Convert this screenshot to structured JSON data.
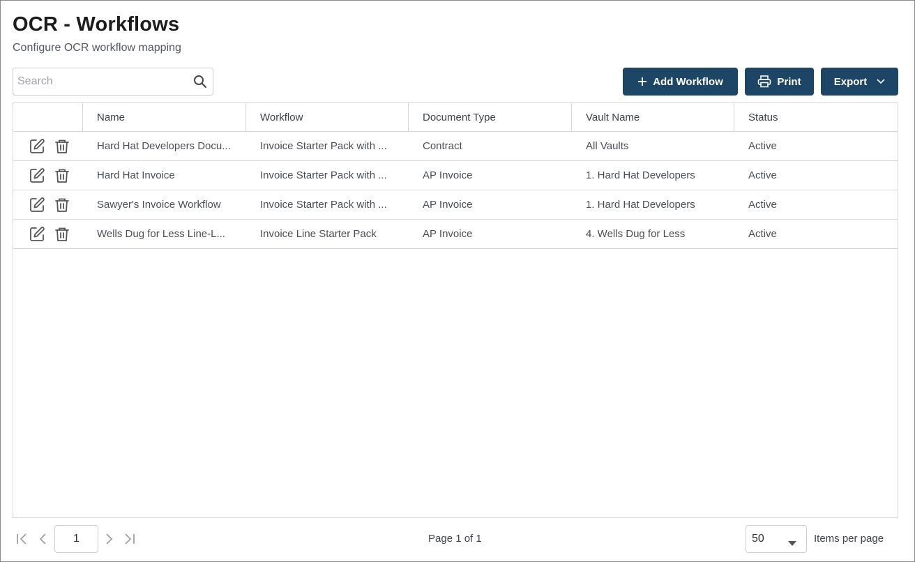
{
  "header": {
    "title": "OCR - Workflows",
    "subtitle": "Configure OCR workflow mapping"
  },
  "toolbar": {
    "search_placeholder": "Search",
    "add_label": "Add Workflow",
    "print_label": "Print",
    "export_label": "Export"
  },
  "table": {
    "columns": [
      "Name",
      "Workflow",
      "Document Type",
      "Vault Name",
      "Status"
    ],
    "rows": [
      {
        "name": "Hard Hat Developers Docu...",
        "workflow": "Invoice Starter Pack with ...",
        "document_type": "Contract",
        "vault_name": "All Vaults",
        "status": "Active"
      },
      {
        "name": "Hard Hat Invoice",
        "workflow": "Invoice Starter Pack with ...",
        "document_type": "AP Invoice",
        "vault_name": "1. Hard Hat Developers",
        "status": "Active"
      },
      {
        "name": "Sawyer's Invoice Workflow",
        "workflow": "Invoice Starter Pack with ...",
        "document_type": "AP Invoice",
        "vault_name": "1. Hard Hat Developers",
        "status": "Active"
      },
      {
        "name": "Wells Dug for Less Line-L...",
        "workflow": "Invoice Line Starter Pack",
        "document_type": "AP Invoice",
        "vault_name": "4. Wells Dug for Less",
        "status": "Active"
      }
    ],
    "row_icons": [
      "edit-icon",
      "trash-icon"
    ]
  },
  "pager": {
    "page_value": "1",
    "page_info": "Page 1 of 1",
    "page_size": "50",
    "items_per_page_label": "Items per page"
  },
  "colors": {
    "primary": "#1d4565",
    "border": "#d3d6da",
    "text": "#4a4f55"
  }
}
